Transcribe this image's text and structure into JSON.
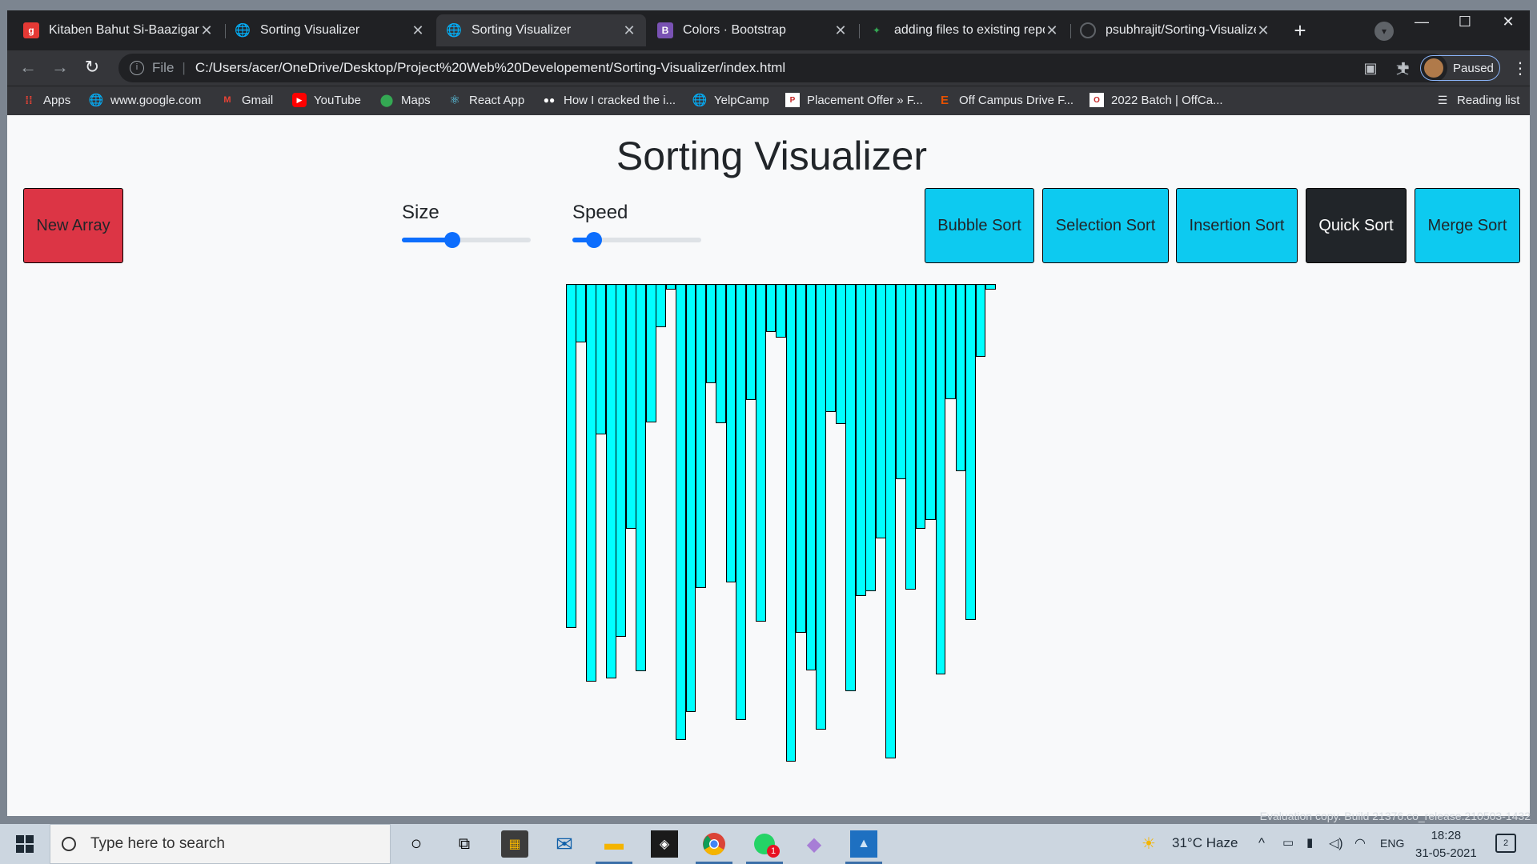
{
  "browser": {
    "tabs": [
      {
        "title": "Kitaben Bahut Si-Baazigar",
        "favicon": "g",
        "favicon_color": "#e53935",
        "active": false
      },
      {
        "title": "Sorting Visualizer",
        "favicon": "globe",
        "active": false
      },
      {
        "title": "Sorting Visualizer",
        "favicon": "globe",
        "active": true
      },
      {
        "title": "Colors · Bootstrap",
        "favicon": "B",
        "favicon_color": "#7952b3",
        "active": false
      },
      {
        "title": "adding files to existing repo",
        "favicon": "pin",
        "active": false
      },
      {
        "title": "psubhrajit/Sorting-Visualizer",
        "favicon": "github",
        "active": false
      }
    ],
    "omnibox": {
      "security_label": "File",
      "url": "C:/Users/acer/OneDrive/Desktop/Project%20Web%20Developement/Sorting-Visualizer/index.html"
    },
    "profile_label": "Paused",
    "bookmarks": [
      {
        "label": "Apps",
        "icon": "apps-icon"
      },
      {
        "label": "www.google.com",
        "icon": "globe-icon"
      },
      {
        "label": "Gmail",
        "icon": "gmail-icon"
      },
      {
        "label": "YouTube",
        "icon": "youtube-icon"
      },
      {
        "label": "Maps",
        "icon": "maps-icon"
      },
      {
        "label": "React App",
        "icon": "react-icon"
      },
      {
        "label": "How I cracked the i...",
        "icon": "medium-icon"
      },
      {
        "label": "YelpCamp",
        "icon": "globe-icon"
      },
      {
        "label": "Placement Offer » F...",
        "icon": "site-icon"
      },
      {
        "label": "Off Campus Drive F...",
        "icon": "site-icon"
      },
      {
        "label": "2022 Batch | OffCa...",
        "icon": "site-icon"
      }
    ],
    "reading_list": "Reading list"
  },
  "page": {
    "title": "Sorting Visualizer",
    "new_array": "New Array",
    "size_label": "Size",
    "speed_label": "Speed",
    "size_value": 0.39,
    "speed_value": 0.17,
    "algorithms": [
      {
        "label": "Bubble Sort",
        "selected": false
      },
      {
        "label": "Selection Sort",
        "selected": false
      },
      {
        "label": "Insertion Sort",
        "selected": false
      },
      {
        "label": "Quick Sort",
        "selected": true
      },
      {
        "label": "Merge Sort",
        "selected": false
      }
    ],
    "array_values": [
      430,
      73,
      497,
      188,
      493,
      441,
      306,
      484,
      173,
      54,
      7,
      570,
      535,
      380,
      124,
      174,
      373,
      545,
      145,
      422,
      60,
      67,
      597,
      436,
      483,
      557,
      160,
      175,
      509,
      390,
      384,
      318,
      593,
      244,
      382,
      306,
      295,
      488,
      144,
      234,
      420,
      91,
      7
    ]
  },
  "colors": {
    "red": "#dc3545",
    "cyan": "#0dcaf0",
    "dark": "#212529",
    "bar": "#00ffff",
    "slider": "#0d6efd"
  },
  "watermark": "Evaluation copy. Build 21376.co_release.210503-1432",
  "taskbar": {
    "search_placeholder": "Type here to search",
    "weather": "31°C  Haze",
    "language": "ENG",
    "time": "18:28",
    "date": "31-05-2021",
    "notification_count": "2",
    "whatsapp_badge": "1"
  }
}
